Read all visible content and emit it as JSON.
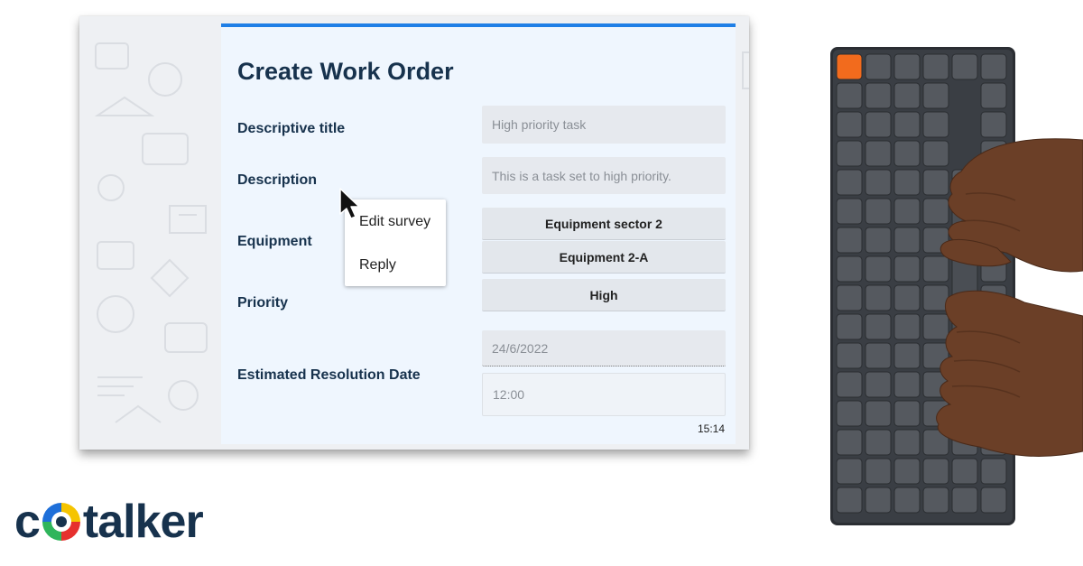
{
  "form": {
    "title": "Create Work Order",
    "fields": {
      "descriptive_title": {
        "label": "Descriptive title",
        "placeholder": "High priority task"
      },
      "description": {
        "label": "Description",
        "placeholder": "This is a task set to high priority."
      },
      "equipment": {
        "label": "Equipment",
        "options": [
          "Equipment sector 2",
          "Equipment 2-A"
        ]
      },
      "priority": {
        "label": "Priority",
        "value": "High"
      },
      "resolution_date": {
        "label": "Estimated Resolution Date",
        "date": "24/6/2022",
        "time": "12:00"
      }
    },
    "clock": "15:14"
  },
  "context_menu": {
    "items": [
      "Edit survey",
      "Reply"
    ]
  },
  "logo": {
    "prefix": "c",
    "suffix": "talker"
  },
  "colors": {
    "accent": "#1f7fe6",
    "heading": "#17324d",
    "card_bg": "#eff6fe",
    "logo_yellow": "#f5c400",
    "logo_red": "#e6302e",
    "logo_green": "#2fb55b",
    "logo_blue": "#1e6fd9",
    "keyboard_accent": "#f26b1d"
  },
  "icons": [
    "mouse-pointer-icon",
    "logo-o-icon"
  ]
}
